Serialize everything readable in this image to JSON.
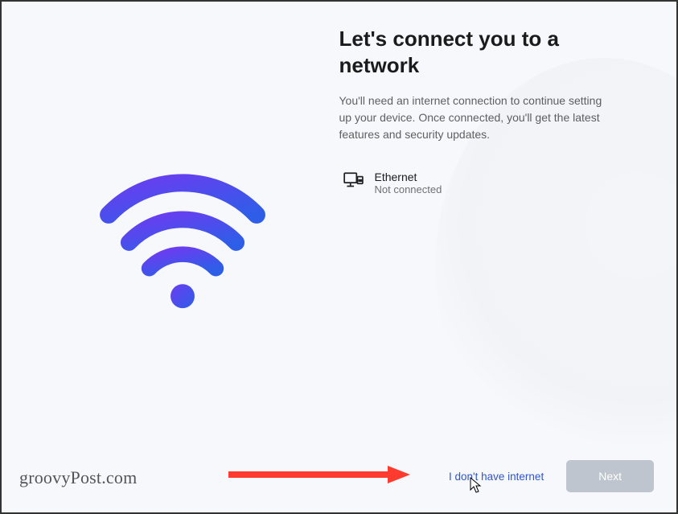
{
  "heading": "Let's connect you to a network",
  "subtext": "You'll need an internet connection to continue setting up your device. Once connected, you'll get the latest features and security updates.",
  "network": {
    "name": "Ethernet",
    "status": "Not connected"
  },
  "footer": {
    "skip_label": "I don't have internet",
    "next_label": "Next"
  },
  "watermark": "groovyPost.com",
  "colors": {
    "accent_blue": "#3154c8",
    "wifi_gradient_start": "#6a3df0",
    "wifi_gradient_end": "#2e5ee8",
    "disabled_button": "#bfc5ce",
    "arrow_red": "#ff3b30"
  }
}
